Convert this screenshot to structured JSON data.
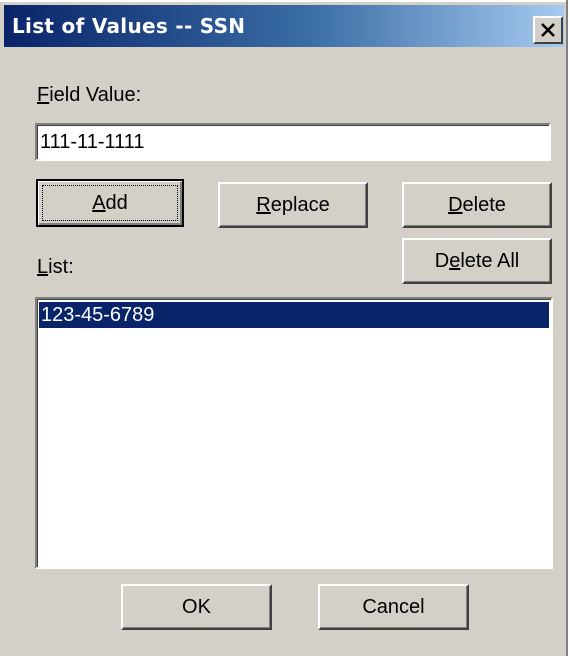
{
  "window": {
    "title": "List of Values -- SSN"
  },
  "titlebar": {
    "close_icon": "close-icon"
  },
  "field_value": {
    "label": "Field Value:",
    "value": "111-11-1111"
  },
  "buttons": {
    "add": {
      "pre": "",
      "mnemonic": "A",
      "post": "dd"
    },
    "replace": {
      "pre": "",
      "mnemonic": "R",
      "post": "eplace"
    },
    "delete": {
      "pre": "",
      "mnemonic": "D",
      "post": "elete"
    },
    "delete_all": {
      "pre": "D",
      "mnemonic": "e",
      "post": "lete All"
    },
    "ok": "OK",
    "cancel": "Cancel"
  },
  "list": {
    "label": "List:",
    "items": [
      {
        "text": "123-45-6789",
        "selected": true
      }
    ]
  },
  "colors": {
    "dialog_face": "#d4d0c8",
    "title_active": "#0a246a",
    "title_gradient_end": "#a6caf0",
    "selection": "#0a246a"
  }
}
